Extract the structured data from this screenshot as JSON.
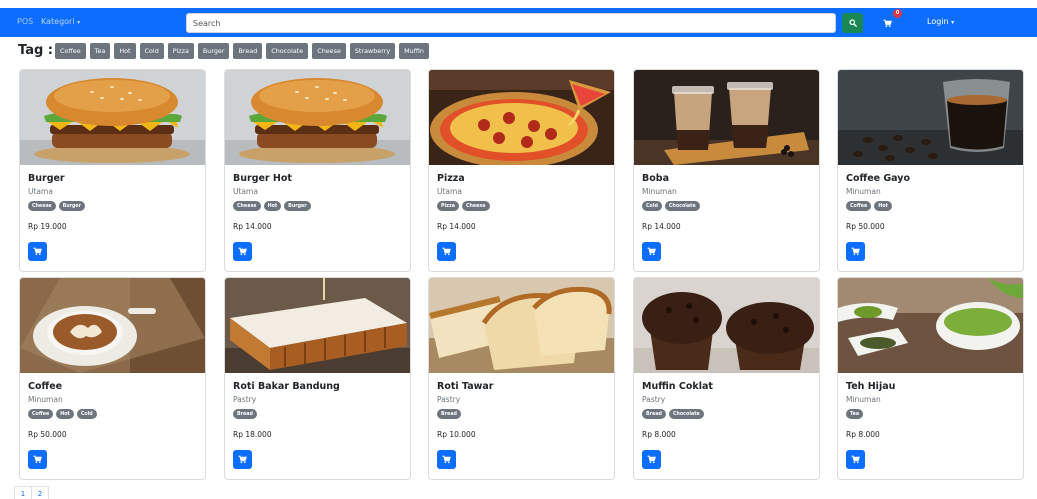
{
  "navbar": {
    "brand": "POS",
    "kategori": "Kategori",
    "search_placeholder": "Search",
    "cart_count": "0",
    "login": "Login"
  },
  "tags": {
    "label": "Tag :",
    "items": [
      "Coffee",
      "Tea",
      "Hot",
      "Cold",
      "Pizza",
      "Burger",
      "Bread",
      "Chocolate",
      "Cheese",
      "Strawberry",
      "Muffin"
    ]
  },
  "products": [
    {
      "name": "Burger",
      "category": "Utama",
      "tags": [
        "Cheese",
        "Burger"
      ],
      "price": "Rp 19.000",
      "image": "burger"
    },
    {
      "name": "Burger Hot",
      "category": "Utama",
      "tags": [
        "Cheese",
        "Hot",
        "Burger"
      ],
      "price": "Rp 14.000",
      "image": "burger"
    },
    {
      "name": "Pizza",
      "category": "Utama",
      "tags": [
        "Pizza",
        "Cheese"
      ],
      "price": "Rp 14.000",
      "image": "pizza"
    },
    {
      "name": "Boba",
      "category": "Minuman",
      "tags": [
        "Cold",
        "Chocolate"
      ],
      "price": "Rp 14.000",
      "image": "boba"
    },
    {
      "name": "Coffee Gayo",
      "category": "Minuman",
      "tags": [
        "Coffee",
        "Hot"
      ],
      "price": "Rp 50.000",
      "image": "coffee-glass"
    },
    {
      "name": "Coffee",
      "category": "Minuman",
      "tags": [
        "Coffee",
        "Hot",
        "Cold"
      ],
      "price": "Rp 50.000",
      "image": "latte"
    },
    {
      "name": "Roti Bakar Bandung",
      "category": "Pastry",
      "tags": [
        "Bread"
      ],
      "price": "Rp 18.000",
      "image": "roti-bakar"
    },
    {
      "name": "Roti Tawar",
      "category": "Pastry",
      "tags": [
        "Bread"
      ],
      "price": "Rp 10.000",
      "image": "roti-tawar"
    },
    {
      "name": "Muffin Coklat",
      "category": "Pastry",
      "tags": [
        "Bread",
        "Chocolate"
      ],
      "price": "Rp 8.000",
      "image": "muffin"
    },
    {
      "name": "Teh Hijau",
      "category": "Minuman",
      "tags": [
        "Tea"
      ],
      "price": "Rp 8.000",
      "image": "green-tea"
    }
  ],
  "pagination": [
    "1",
    "2"
  ],
  "colors": {
    "primary": "#0d6efd",
    "success": "#198754",
    "secondary": "#6c757d",
    "danger": "#dc3545"
  }
}
